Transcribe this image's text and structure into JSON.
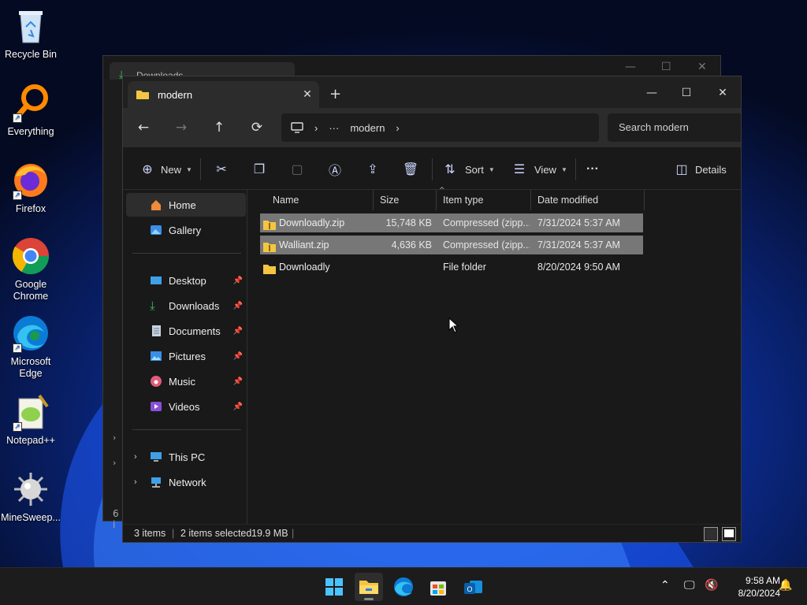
{
  "desktop": {
    "icons": [
      {
        "label": "Recycle Bin",
        "icon": "recycle-bin-icon"
      },
      {
        "label": "Everything",
        "icon": "everything-search-icon"
      },
      {
        "label": "Firefox",
        "icon": "firefox-icon"
      },
      {
        "label": "Google Chrome",
        "icon": "chrome-icon"
      },
      {
        "label": "Microsoft Edge",
        "icon": "edge-icon"
      },
      {
        "label": "Notepad++",
        "icon": "notepadpp-icon"
      },
      {
        "label": "MineSweep...",
        "icon": "minesweeper-icon"
      }
    ]
  },
  "back_window": {
    "tab_title": "Downloads",
    "side_hint": "6 i"
  },
  "window": {
    "tab_title": "modern",
    "tab_close": "✕",
    "new_tab": "+",
    "controls": {
      "minimize": "—",
      "maximize": "☐",
      "close": "✕"
    }
  },
  "nav": {
    "back": "←",
    "forward": "→",
    "up": "↑",
    "refresh": "⟳",
    "breadcrumb": {
      "more": "···",
      "folder": "modern",
      "sep": "›"
    },
    "search_placeholder": "Search modern"
  },
  "toolbar": {
    "new_label": "New",
    "sort_label": "Sort",
    "view_label": "View",
    "more_label": "···",
    "details_label": "Details"
  },
  "sidebar": {
    "items": [
      {
        "label": "Home",
        "icon": "home-icon",
        "pinned": false
      },
      {
        "label": "Gallery",
        "icon": "gallery-icon",
        "pinned": false
      },
      {
        "label": "Desktop",
        "icon": "desktop-folder-icon",
        "pinned": true
      },
      {
        "label": "Downloads",
        "icon": "downloads-icon",
        "pinned": true
      },
      {
        "label": "Documents",
        "icon": "documents-icon",
        "pinned": true
      },
      {
        "label": "Pictures",
        "icon": "pictures-icon",
        "pinned": true
      },
      {
        "label": "Music",
        "icon": "music-icon",
        "pinned": true
      },
      {
        "label": "Videos",
        "icon": "videos-icon",
        "pinned": true
      },
      {
        "label": "This PC",
        "icon": "this-pc-icon",
        "pinned": false
      },
      {
        "label": "Network",
        "icon": "network-icon",
        "pinned": false
      }
    ]
  },
  "file_list": {
    "columns": [
      "Name",
      "Size",
      "Item type",
      "Date modified"
    ],
    "rows": [
      {
        "name": "Downloadly.zip",
        "size": "15,748 KB",
        "type": "Compressed (zipp...",
        "date": "7/31/2024 5:37 AM",
        "selected": true,
        "icon": "zip-folder-icon"
      },
      {
        "name": "Walliant.zip",
        "size": "4,636 KB",
        "type": "Compressed (zipp...",
        "date": "7/31/2024 5:37 AM",
        "selected": true,
        "icon": "zip-folder-icon"
      },
      {
        "name": "Downloadly",
        "size": "",
        "type": "File folder",
        "date": "8/20/2024 9:50 AM",
        "selected": false,
        "icon": "folder-icon"
      }
    ]
  },
  "status": {
    "item_count": "3 items",
    "selection": "2 items selected",
    "selection_size": "19.9 MB",
    "separator": "|"
  },
  "taskbar": {
    "apps": [
      "start-icon",
      "file-explorer-icon",
      "edge-icon",
      "store-icon",
      "outlook-icon"
    ],
    "time": "9:58 AM",
    "date": "8/20/2024"
  },
  "colors": {
    "accent": "#4cc2ff",
    "selection": "#777777",
    "folder_yellow": "#f5c542"
  }
}
